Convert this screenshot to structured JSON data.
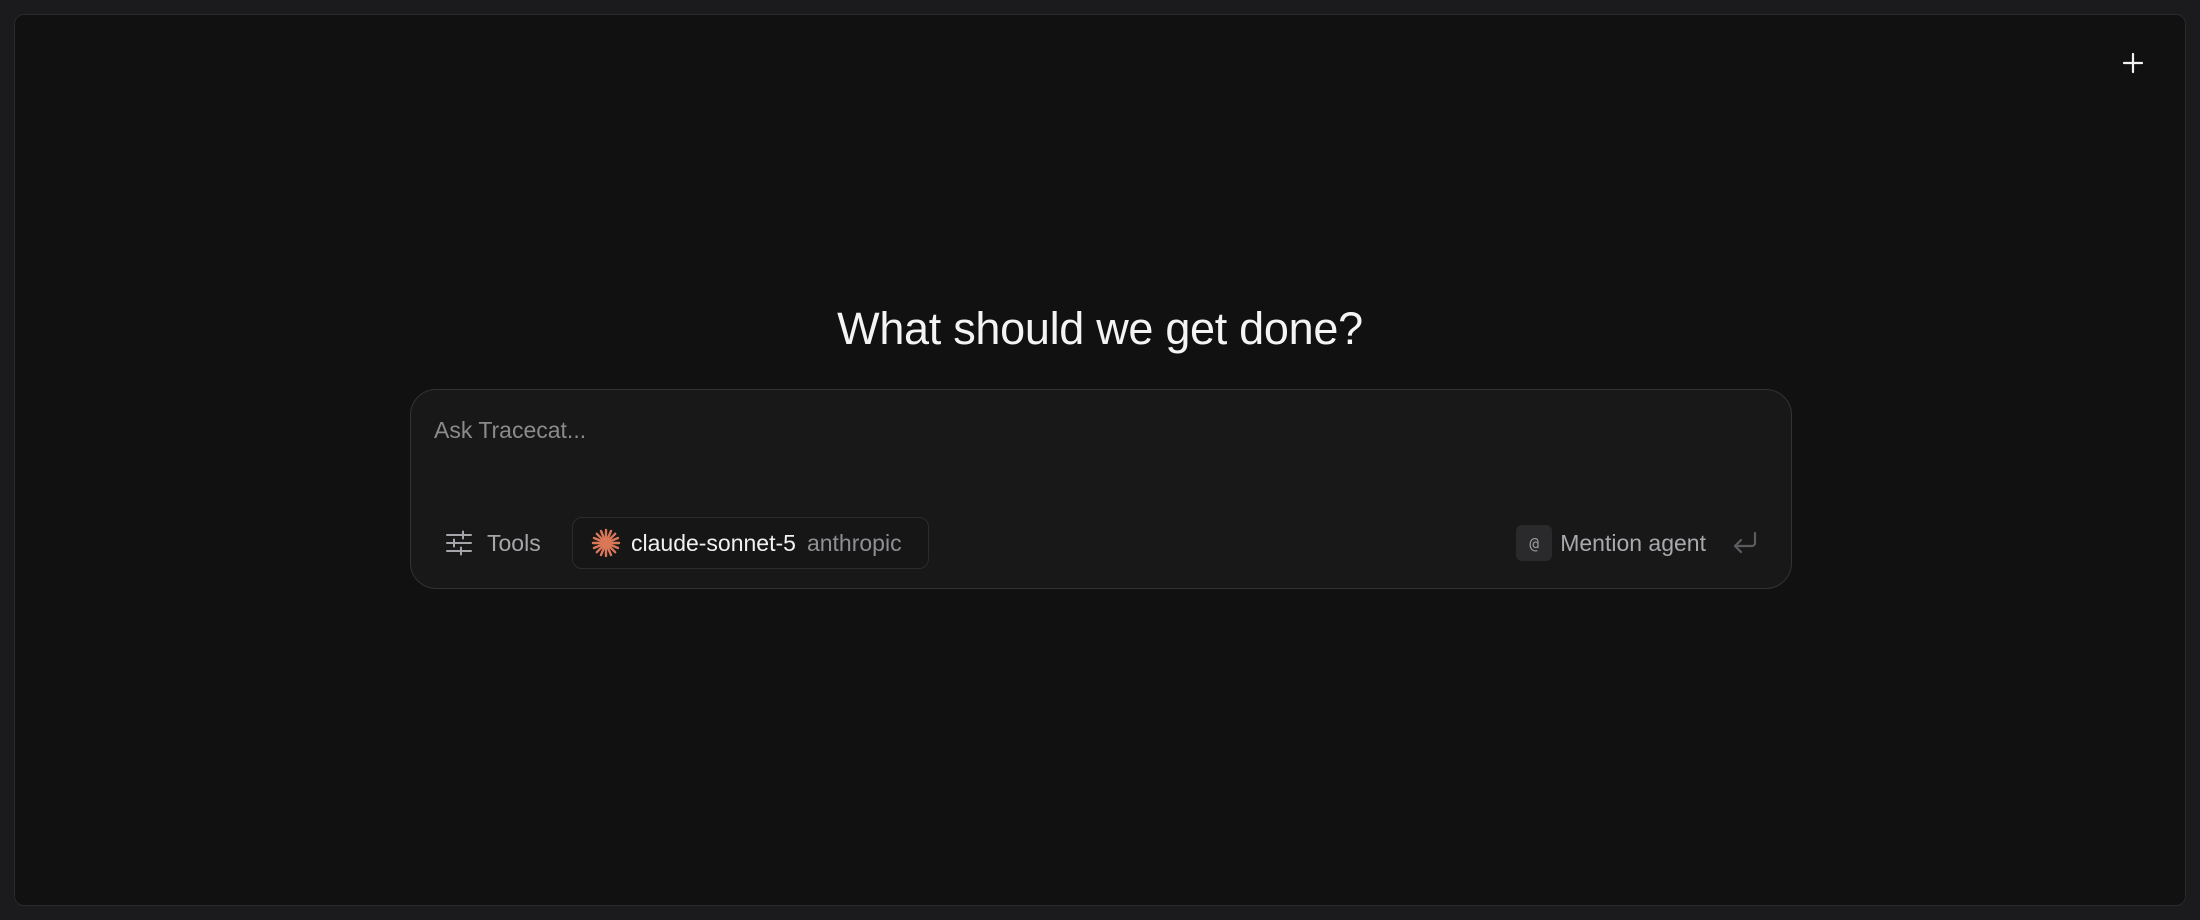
{
  "header": {
    "new_chat_icon": "plus-icon"
  },
  "main": {
    "title": "What should we get done?"
  },
  "composer": {
    "placeholder": "Ask Tracecat...",
    "value": "",
    "tools_label": "Tools",
    "tools_icon": "sliders-icon",
    "model": {
      "name": "claude-sonnet-5",
      "provider": "anthropic",
      "icon": "anthropic-star-icon",
      "icon_color": "#d97757"
    },
    "mention": {
      "badge": "@",
      "label": "Mention agent"
    },
    "send_icon": "enter-arrow-icon"
  }
}
